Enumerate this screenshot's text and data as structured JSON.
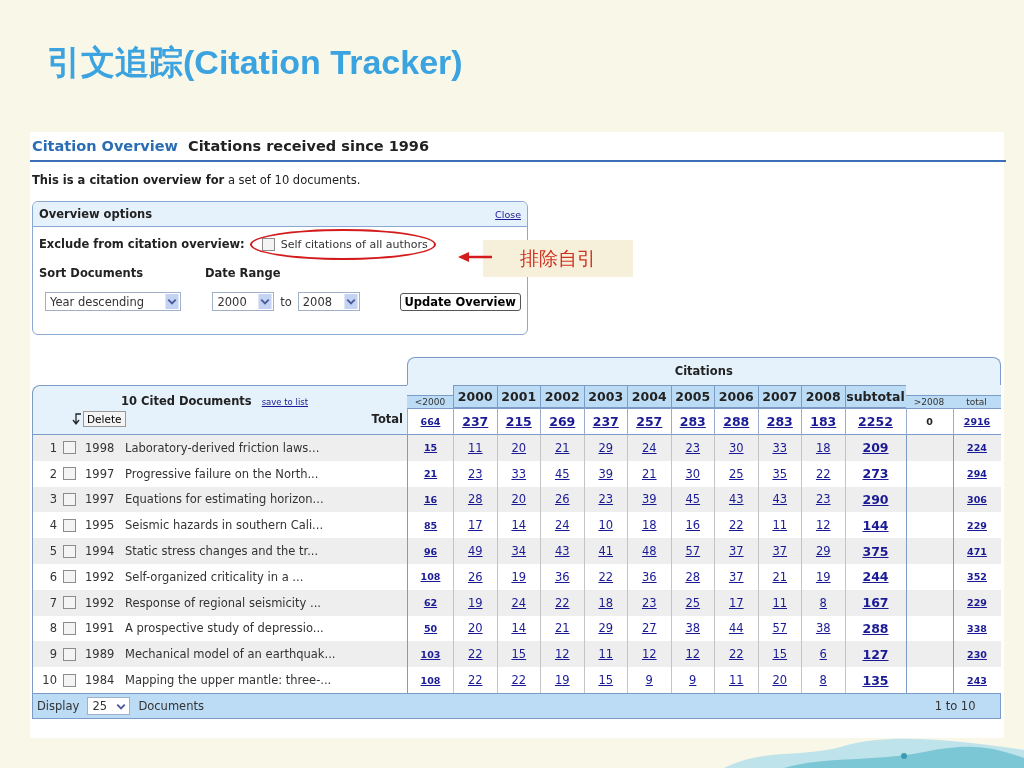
{
  "slide_title": "引文追踪(Citation Tracker)",
  "header": {
    "link_title": "Citation Overview",
    "subtitle": "Citations received since 1996"
  },
  "intro": "**This is a citation overview for** a set of 10 documents.",
  "options": {
    "title": "Overview options",
    "close": "Close",
    "exclude_label": "Exclude from citation overview:",
    "self_citations": {
      "label": "Self citations of all authors",
      "checked": false
    },
    "sort_label": "Sort Documents",
    "sort_value": "Year descending",
    "date_label": "Date Range",
    "from": "2000",
    "to_word": "to",
    "to": "2008",
    "button": "Update Overview"
  },
  "annotation": {
    "label": "排除自引"
  },
  "table": {
    "cited_title": "10 Cited Documents",
    "save_link": "save to list",
    "delete_button": "Delete",
    "total_label": "Total",
    "citations_header": "Citations",
    "columns": [
      {
        "label": "<2000",
        "kind": "outer"
      },
      {
        "label": "2000",
        "kind": "year"
      },
      {
        "label": "2001",
        "kind": "year"
      },
      {
        "label": "2002",
        "kind": "year"
      },
      {
        "label": "2003",
        "kind": "year"
      },
      {
        "label": "2004",
        "kind": "year"
      },
      {
        "label": "2005",
        "kind": "year"
      },
      {
        "label": "2006",
        "kind": "year"
      },
      {
        "label": "2007",
        "kind": "year"
      },
      {
        "label": "2008",
        "kind": "year"
      },
      {
        "label": "subtotal",
        "kind": "subtotal"
      },
      {
        "label": ">2008",
        "kind": "after"
      },
      {
        "label": "total",
        "kind": "outer"
      }
    ],
    "totals": [
      "664",
      "237",
      "215",
      "269",
      "237",
      "257",
      "283",
      "288",
      "283",
      "183",
      "2252",
      "0",
      "2916"
    ],
    "rows": [
      {
        "num": "1",
        "checked": false,
        "year": "1998",
        "title": "Laboratory-derived friction laws...",
        "values": [
          "15",
          "11",
          "20",
          "21",
          "29",
          "24",
          "23",
          "30",
          "33",
          "18",
          "209",
          "224"
        ]
      },
      {
        "num": "2",
        "checked": false,
        "year": "1997",
        "title": "Progressive failure on the North...",
        "values": [
          "21",
          "23",
          "33",
          "45",
          "39",
          "21",
          "30",
          "25",
          "35",
          "22",
          "273",
          "294"
        ]
      },
      {
        "num": "3",
        "checked": false,
        "year": "1997",
        "title": "Equations for estimating horizon...",
        "values": [
          "16",
          "28",
          "20",
          "26",
          "23",
          "39",
          "45",
          "43",
          "43",
          "23",
          "290",
          "306"
        ]
      },
      {
        "num": "4",
        "checked": false,
        "year": "1995",
        "title": "Seismic hazards in southern Cali...",
        "values": [
          "85",
          "17",
          "14",
          "24",
          "10",
          "18",
          "16",
          "22",
          "11",
          "12",
          "144",
          "229"
        ]
      },
      {
        "num": "5",
        "checked": false,
        "year": "1994",
        "title": "Static stress changes and the tr...",
        "values": [
          "96",
          "49",
          "34",
          "43",
          "41",
          "48",
          "57",
          "37",
          "37",
          "29",
          "375",
          "471"
        ]
      },
      {
        "num": "6",
        "checked": false,
        "year": "1992",
        "title": "Self-organized criticality in a ...",
        "values": [
          "108",
          "26",
          "19",
          "36",
          "22",
          "36",
          "28",
          "37",
          "21",
          "19",
          "244",
          "352"
        ]
      },
      {
        "num": "7",
        "checked": false,
        "year": "1992",
        "title": "Response of regional seismicity ...",
        "values": [
          "62",
          "19",
          "24",
          "22",
          "18",
          "23",
          "25",
          "17",
          "11",
          "8",
          "167",
          "229"
        ]
      },
      {
        "num": "8",
        "checked": false,
        "year": "1991",
        "title": "A prospective study of depressio...",
        "values": [
          "50",
          "20",
          "14",
          "21",
          "29",
          "27",
          "38",
          "44",
          "57",
          "38",
          "288",
          "338"
        ]
      },
      {
        "num": "9",
        "checked": false,
        "year": "1989",
        "title": "Mechanical model of an earthquak...",
        "values": [
          "103",
          "22",
          "15",
          "12",
          "11",
          "12",
          "12",
          "22",
          "15",
          "6",
          "127",
          "230"
        ]
      },
      {
        "num": "10",
        "checked": false,
        "year": "1984",
        "title": "Mapping the upper mantle: three-...",
        "values": [
          "108",
          "22",
          "22",
          "19",
          "15",
          "9",
          "9",
          "11",
          "20",
          "8",
          "135",
          "243"
        ]
      }
    ]
  },
  "footer": {
    "display_label": "Display",
    "display_value": "25",
    "documents_label": "Documents",
    "range": "1 to 10"
  }
}
